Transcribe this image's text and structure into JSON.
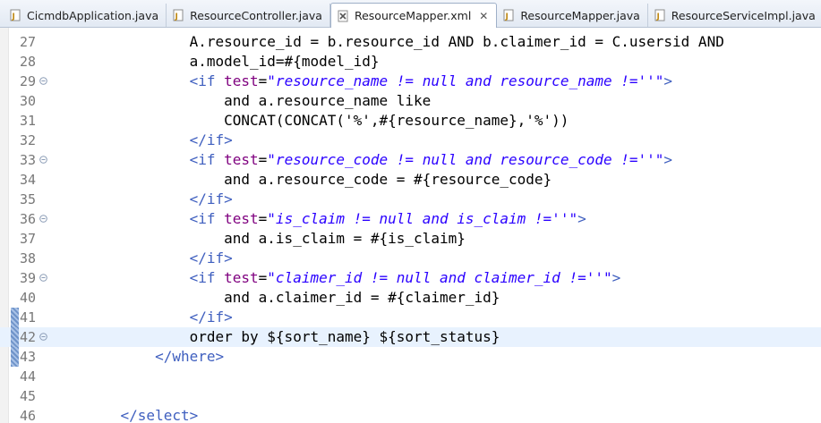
{
  "tabs": [
    {
      "label": "CicmdbApplication.java",
      "icon": "java-file-icon",
      "active": false
    },
    {
      "label": "ResourceController.java",
      "icon": "java-file-icon",
      "active": false
    },
    {
      "label": "ResourceMapper.xml",
      "icon": "xml-file-icon",
      "active": true,
      "close": "✕"
    },
    {
      "label": "ResourceMapper.java",
      "icon": "java-file-icon",
      "active": false
    },
    {
      "label": "ResourceServiceImpl.java",
      "icon": "java-file-icon",
      "active": false
    }
  ],
  "editor": {
    "current_line": 42,
    "lines": [
      {
        "n": "27",
        "segs": [
          {
            "c": "t",
            "s": "            A.resource_id = b.resource_id AND b.claimer_id = C.usersid AND"
          }
        ]
      },
      {
        "n": "28",
        "segs": [
          {
            "c": "t",
            "s": "            a.model_id=#{model_id}"
          }
        ]
      },
      {
        "n": "29",
        "fold": true,
        "segs": [
          {
            "c": "k",
            "s": "            <if "
          },
          {
            "c": "a",
            "s": "test"
          },
          {
            "c": "t",
            "s": "="
          },
          {
            "c": "v",
            "s": "\"resource_name != null and resource_name !=''\""
          },
          {
            "c": "k",
            "s": ">"
          }
        ]
      },
      {
        "n": "30",
        "segs": [
          {
            "c": "t",
            "s": "                and a.resource_name like"
          }
        ]
      },
      {
        "n": "31",
        "segs": [
          {
            "c": "t",
            "s": "                CONCAT(CONCAT('%',#{resource_name},'%'))"
          }
        ]
      },
      {
        "n": "32",
        "segs": [
          {
            "c": "k",
            "s": "            </if>"
          }
        ]
      },
      {
        "n": "33",
        "fold": true,
        "segs": [
          {
            "c": "k",
            "s": "            <if "
          },
          {
            "c": "a",
            "s": "test"
          },
          {
            "c": "t",
            "s": "="
          },
          {
            "c": "v",
            "s": "\"resource_code != null and resource_code !=''\""
          },
          {
            "c": "k",
            "s": ">"
          }
        ]
      },
      {
        "n": "34",
        "segs": [
          {
            "c": "t",
            "s": "                and a.resource_code = #{resource_code}"
          }
        ]
      },
      {
        "n": "35",
        "segs": [
          {
            "c": "k",
            "s": "            </if>"
          }
        ]
      },
      {
        "n": "36",
        "fold": true,
        "segs": [
          {
            "c": "k",
            "s": "            <if "
          },
          {
            "c": "a",
            "s": "test"
          },
          {
            "c": "t",
            "s": "="
          },
          {
            "c": "v",
            "s": "\"is_claim != null and is_claim !=''\""
          },
          {
            "c": "k",
            "s": ">"
          }
        ]
      },
      {
        "n": "37",
        "segs": [
          {
            "c": "t",
            "s": "                and a.is_claim = #{is_claim}"
          }
        ]
      },
      {
        "n": "38",
        "segs": [
          {
            "c": "k",
            "s": "            </if>"
          }
        ]
      },
      {
        "n": "39",
        "fold": true,
        "segs": [
          {
            "c": "k",
            "s": "            <if "
          },
          {
            "c": "a",
            "s": "test"
          },
          {
            "c": "t",
            "s": "="
          },
          {
            "c": "v",
            "s": "\"claimer_id != null and claimer_id !=''\""
          },
          {
            "c": "k",
            "s": ">"
          }
        ]
      },
      {
        "n": "40",
        "segs": [
          {
            "c": "t",
            "s": "                and a.claimer_id = #{claimer_id}"
          }
        ]
      },
      {
        "n": "41",
        "mark": true,
        "segs": [
          {
            "c": "k",
            "s": "            </if>"
          }
        ]
      },
      {
        "n": "42",
        "mark": true,
        "fold": true,
        "segs": [
          {
            "c": "t",
            "s": "            order by ${sort_name} ${sort_status}"
          }
        ]
      },
      {
        "n": "43",
        "mark": true,
        "segs": [
          {
            "c": "k",
            "s": "        </where>"
          }
        ]
      },
      {
        "n": "44",
        "segs": []
      },
      {
        "n": "45",
        "segs": []
      },
      {
        "n": "46",
        "segs": [
          {
            "c": "k",
            "s": "    </select>"
          }
        ]
      }
    ]
  }
}
